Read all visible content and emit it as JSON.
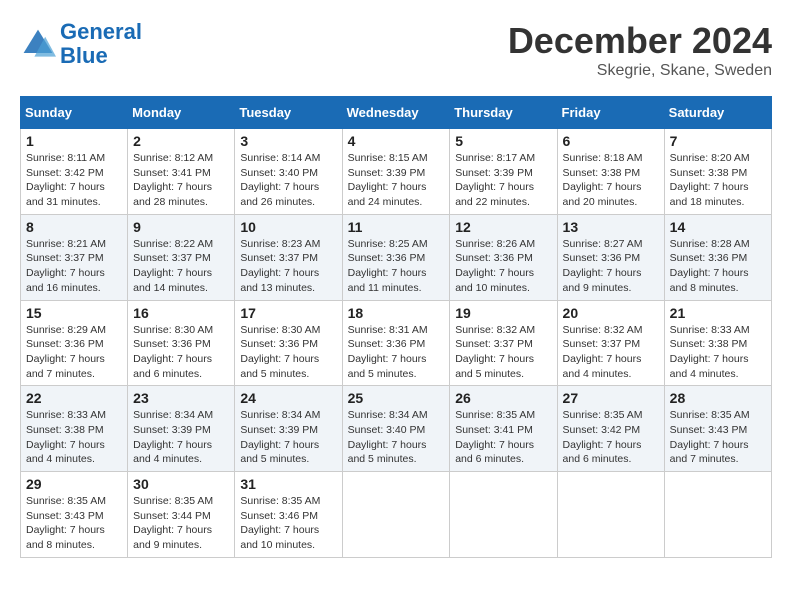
{
  "header": {
    "logo_line1": "General",
    "logo_line2": "Blue",
    "month": "December 2024",
    "location": "Skegrie, Skane, Sweden"
  },
  "days_of_week": [
    "Sunday",
    "Monday",
    "Tuesday",
    "Wednesday",
    "Thursday",
    "Friday",
    "Saturday"
  ],
  "weeks": [
    [
      {
        "day": "1",
        "info": "Sunrise: 8:11 AM\nSunset: 3:42 PM\nDaylight: 7 hours and 31 minutes."
      },
      {
        "day": "2",
        "info": "Sunrise: 8:12 AM\nSunset: 3:41 PM\nDaylight: 7 hours and 28 minutes."
      },
      {
        "day": "3",
        "info": "Sunrise: 8:14 AM\nSunset: 3:40 PM\nDaylight: 7 hours and 26 minutes."
      },
      {
        "day": "4",
        "info": "Sunrise: 8:15 AM\nSunset: 3:39 PM\nDaylight: 7 hours and 24 minutes."
      },
      {
        "day": "5",
        "info": "Sunrise: 8:17 AM\nSunset: 3:39 PM\nDaylight: 7 hours and 22 minutes."
      },
      {
        "day": "6",
        "info": "Sunrise: 8:18 AM\nSunset: 3:38 PM\nDaylight: 7 hours and 20 minutes."
      },
      {
        "day": "7",
        "info": "Sunrise: 8:20 AM\nSunset: 3:38 PM\nDaylight: 7 hours and 18 minutes."
      }
    ],
    [
      {
        "day": "8",
        "info": "Sunrise: 8:21 AM\nSunset: 3:37 PM\nDaylight: 7 hours and 16 minutes."
      },
      {
        "day": "9",
        "info": "Sunrise: 8:22 AM\nSunset: 3:37 PM\nDaylight: 7 hours and 14 minutes."
      },
      {
        "day": "10",
        "info": "Sunrise: 8:23 AM\nSunset: 3:37 PM\nDaylight: 7 hours and 13 minutes."
      },
      {
        "day": "11",
        "info": "Sunrise: 8:25 AM\nSunset: 3:36 PM\nDaylight: 7 hours and 11 minutes."
      },
      {
        "day": "12",
        "info": "Sunrise: 8:26 AM\nSunset: 3:36 PM\nDaylight: 7 hours and 10 minutes."
      },
      {
        "day": "13",
        "info": "Sunrise: 8:27 AM\nSunset: 3:36 PM\nDaylight: 7 hours and 9 minutes."
      },
      {
        "day": "14",
        "info": "Sunrise: 8:28 AM\nSunset: 3:36 PM\nDaylight: 7 hours and 8 minutes."
      }
    ],
    [
      {
        "day": "15",
        "info": "Sunrise: 8:29 AM\nSunset: 3:36 PM\nDaylight: 7 hours and 7 minutes."
      },
      {
        "day": "16",
        "info": "Sunrise: 8:30 AM\nSunset: 3:36 PM\nDaylight: 7 hours and 6 minutes."
      },
      {
        "day": "17",
        "info": "Sunrise: 8:30 AM\nSunset: 3:36 PM\nDaylight: 7 hours and 5 minutes."
      },
      {
        "day": "18",
        "info": "Sunrise: 8:31 AM\nSunset: 3:36 PM\nDaylight: 7 hours and 5 minutes."
      },
      {
        "day": "19",
        "info": "Sunrise: 8:32 AM\nSunset: 3:37 PM\nDaylight: 7 hours and 5 minutes."
      },
      {
        "day": "20",
        "info": "Sunrise: 8:32 AM\nSunset: 3:37 PM\nDaylight: 7 hours and 4 minutes."
      },
      {
        "day": "21",
        "info": "Sunrise: 8:33 AM\nSunset: 3:38 PM\nDaylight: 7 hours and 4 minutes."
      }
    ],
    [
      {
        "day": "22",
        "info": "Sunrise: 8:33 AM\nSunset: 3:38 PM\nDaylight: 7 hours and 4 minutes."
      },
      {
        "day": "23",
        "info": "Sunrise: 8:34 AM\nSunset: 3:39 PM\nDaylight: 7 hours and 4 minutes."
      },
      {
        "day": "24",
        "info": "Sunrise: 8:34 AM\nSunset: 3:39 PM\nDaylight: 7 hours and 5 minutes."
      },
      {
        "day": "25",
        "info": "Sunrise: 8:34 AM\nSunset: 3:40 PM\nDaylight: 7 hours and 5 minutes."
      },
      {
        "day": "26",
        "info": "Sunrise: 8:35 AM\nSunset: 3:41 PM\nDaylight: 7 hours and 6 minutes."
      },
      {
        "day": "27",
        "info": "Sunrise: 8:35 AM\nSunset: 3:42 PM\nDaylight: 7 hours and 6 minutes."
      },
      {
        "day": "28",
        "info": "Sunrise: 8:35 AM\nSunset: 3:43 PM\nDaylight: 7 hours and 7 minutes."
      }
    ],
    [
      {
        "day": "29",
        "info": "Sunrise: 8:35 AM\nSunset: 3:43 PM\nDaylight: 7 hours and 8 minutes."
      },
      {
        "day": "30",
        "info": "Sunrise: 8:35 AM\nSunset: 3:44 PM\nDaylight: 7 hours and 9 minutes."
      },
      {
        "day": "31",
        "info": "Sunrise: 8:35 AM\nSunset: 3:46 PM\nDaylight: 7 hours and 10 minutes."
      },
      null,
      null,
      null,
      null
    ]
  ]
}
